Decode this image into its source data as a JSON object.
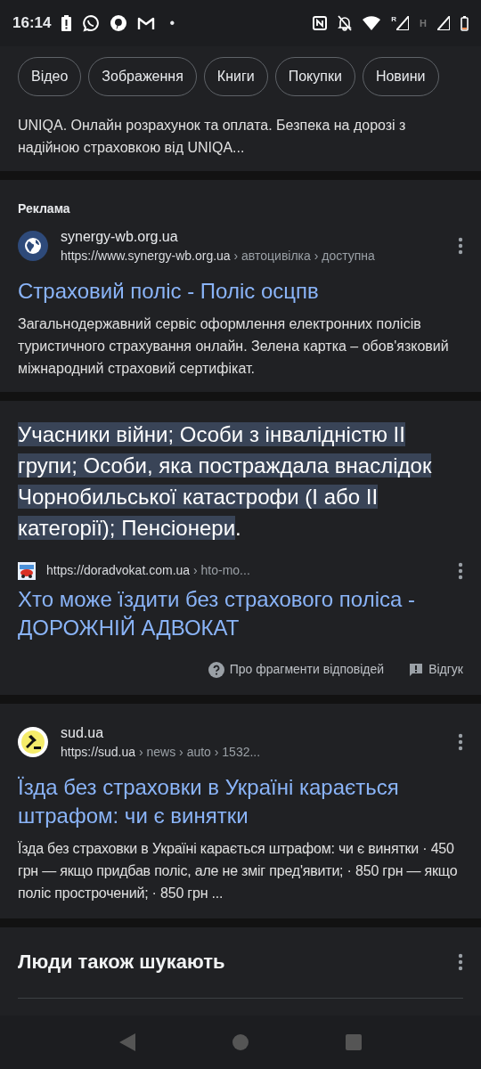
{
  "status_bar": {
    "time": "16:14",
    "bullet": "•",
    "network_letter_r": "R",
    "network_letter_h": "H"
  },
  "chips": [
    {
      "label": "Відео",
      "selected": false
    },
    {
      "label": "Зображення",
      "selected": false
    },
    {
      "label": "Книги",
      "selected": false
    },
    {
      "label": "Покупки",
      "selected": false
    },
    {
      "label": "Новини",
      "selected": false
    }
  ],
  "partial_result": {
    "snippet": "UNIQA. Онлайн розрахунок та оплата. Безпека на дорозі з надійною страховкою від UNIQA..."
  },
  "ad_result": {
    "label": "Реклама",
    "site_name": "synergy-wb.org.ua",
    "url": "https://www.synergy-wb.org.ua",
    "path": " › автоцивілка › доступна",
    "title": "Страховий поліс - Поліс осцпв",
    "snippet": "Загальнодержавний сервіс оформлення електронних полісів туристичного страхування онлайн. Зелена картка – обов'язковий міжнародний страховий сертифікат."
  },
  "featured_snippet": {
    "parts": [
      {
        "text": "Учасники війни; Особи з інвалідністю II групи; Особи, яка постраждала внаслідок Чорнобильської катастрофи (I або II категорії); Пенсіонери",
        "highlighted": true
      },
      {
        "text": ".",
        "highlighted": false
      }
    ],
    "url": "https://doradvokat.com.ua",
    "path": " › hto-mo...",
    "title": "Хто може їздити без страхового поліса - ДОРОЖНІЙ АДВОКАТ",
    "about_link": "Про фрагменти відповідей",
    "feedback_link": "Відгук"
  },
  "news_result": {
    "site_name": "sud.ua",
    "url": "https://sud.ua",
    "path": " › news › auto › 1532...",
    "title": "Їзда без страховки в Україні карається штрафом: чи є винятки",
    "snippet": "Їзда без страховки в Україні карається штрафом: чи є винятки · 450 грн — якщо придбав поліс, але не зміг пред'явити; · 850 грн — якщо поліс прострочений; · 850 грн ..."
  },
  "people_also_search": {
    "heading": "Люди також шукають"
  }
}
